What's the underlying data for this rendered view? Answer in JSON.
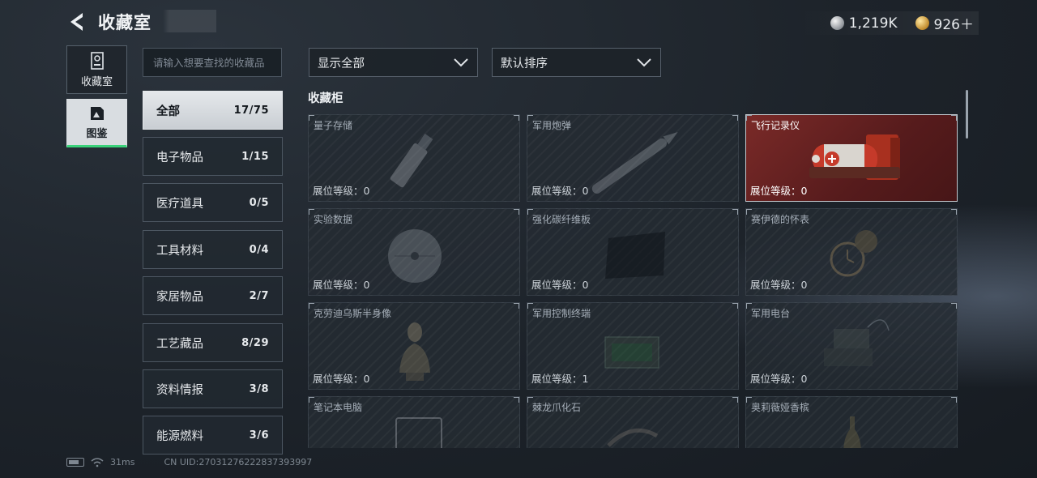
{
  "header": {
    "title": "收藏室"
  },
  "currency": [
    {
      "icon": "silver-coin-icon",
      "value": "1,219K"
    },
    {
      "icon": "gold-coin-icon",
      "value": "926＋"
    }
  ],
  "side_tabs": [
    {
      "label": "收藏室",
      "icon": "trophy-display-icon",
      "active": false
    },
    {
      "label": "图鉴",
      "icon": "codex-icon",
      "active": true
    }
  ],
  "search": {
    "placeholder": "请输入想要查找的收藏品"
  },
  "categories": [
    {
      "label": "全部",
      "count": "17/75",
      "active": true
    },
    {
      "label": "电子物品",
      "count": "1/15"
    },
    {
      "label": "医疗道具",
      "count": "0/5"
    },
    {
      "label": "工具材料",
      "count": "0/4"
    },
    {
      "label": "家居物品",
      "count": "2/7"
    },
    {
      "label": "工艺藏品",
      "count": "8/29"
    },
    {
      "label": "资料情报",
      "count": "3/8"
    },
    {
      "label": "能源燃料",
      "count": "3/6"
    }
  ],
  "filters": {
    "display": "显示全部",
    "sort": "默认排序"
  },
  "section": {
    "title": "收藏柜"
  },
  "level_prefix": "展位等级：",
  "items": [
    {
      "name": "量子存储",
      "level": "0",
      "icon": "usb-drive-icon"
    },
    {
      "name": "军用炮弹",
      "level": "0",
      "icon": "artillery-shell-icon"
    },
    {
      "name": "飞行记录仪",
      "level": "0",
      "icon": "flight-recorder-icon",
      "featured": true
    },
    {
      "name": "实验数据",
      "level": "0",
      "icon": "data-disc-icon"
    },
    {
      "name": "强化碳纤维板",
      "level": "0",
      "icon": "carbon-plate-icon"
    },
    {
      "name": "赛伊德的怀表",
      "level": "0",
      "icon": "pocket-watch-icon"
    },
    {
      "name": "克劳迪乌斯半身像",
      "level": "0",
      "icon": "bust-statue-icon"
    },
    {
      "name": "军用控制终端",
      "level": "1",
      "icon": "control-terminal-icon"
    },
    {
      "name": "军用电台",
      "level": "0",
      "icon": "military-radio-icon"
    },
    {
      "name": "笔记本电脑",
      "level": "",
      "icon": "laptop-icon"
    },
    {
      "name": "棘龙爪化石",
      "level": "",
      "icon": "claw-fossil-icon"
    },
    {
      "name": "奥莉薇娅香槟",
      "level": "",
      "icon": "champagne-icon"
    }
  ],
  "status": {
    "ping": "31ms",
    "uid": "CN UID:27031276222837393997"
  },
  "colors": {
    "accent_green": "#3ad27a",
    "featured_red": "#7a2a28"
  }
}
